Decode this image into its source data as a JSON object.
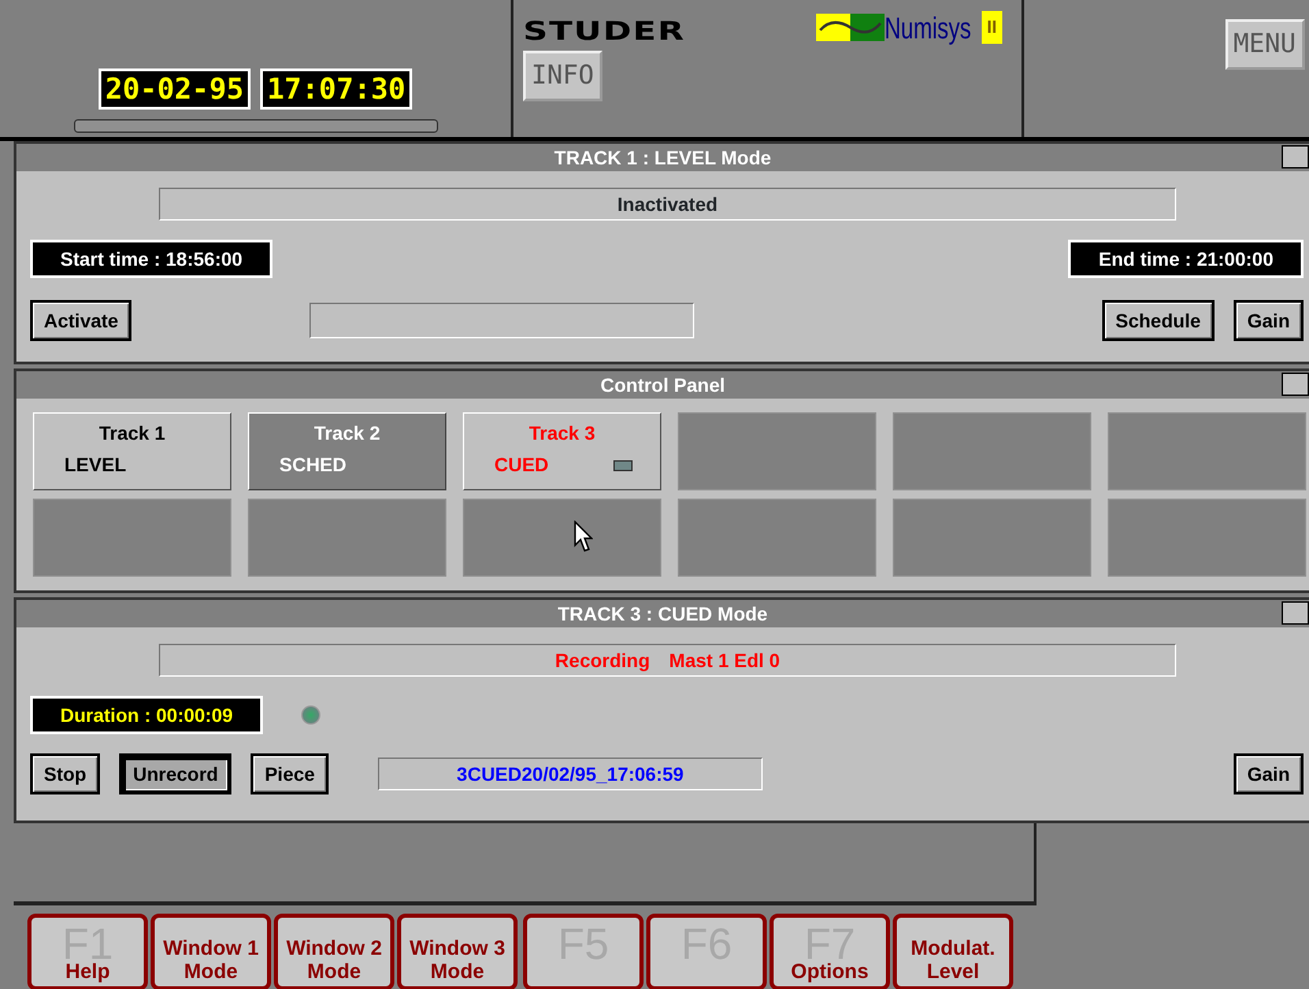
{
  "header": {
    "date": "20-02-95",
    "time": "17:07:30",
    "logo": "STUDER",
    "brand": "Numisys",
    "brand_suffix": "II",
    "info_button": "INFO",
    "menu_button": "MENU"
  },
  "track_window": {
    "title": "TRACK 1 : LEVEL Mode",
    "status": "Inactivated",
    "start_time": "Start time : 18:56:00",
    "end_time": "End time : 21:00:00",
    "left_buttons": [
      {
        "label": "Activate",
        "focused": false
      }
    ],
    "right_buttons": [
      {
        "label": "Schedule",
        "focused": false
      },
      {
        "label": "Gain",
        "focused": false
      }
    ]
  },
  "control_panel": {
    "title": "Control Panel",
    "slots": [
      {
        "kind": "idle",
        "name": "Track 1",
        "mode": "LEVEL"
      },
      {
        "kind": "scheduled",
        "name": "Track 2",
        "mode": "SCHED"
      },
      {
        "kind": "cued",
        "name": "Track 3",
        "mode": "CUED"
      },
      {
        "kind": "empty"
      },
      {
        "kind": "empty"
      },
      {
        "kind": "empty"
      },
      {
        "kind": "empty"
      },
      {
        "kind": "empty"
      },
      {
        "kind": "empty"
      },
      {
        "kind": "empty"
      },
      {
        "kind": "empty"
      },
      {
        "kind": "empty"
      }
    ]
  },
  "cued_window": {
    "title": "TRACK 3 : CUED Mode",
    "status": [
      "Recording",
      "Mast 1 Edl 0"
    ],
    "duration": "Duration : 00:00:09",
    "take_name": "3CUED20/02/95_17:06:59",
    "left_buttons": [
      {
        "label": "Stop",
        "focused": false
      },
      {
        "label": "Unrecord",
        "focused": true
      },
      {
        "label": "Piece",
        "focused": false
      }
    ],
    "right_buttons": [
      {
        "label": "Gain",
        "focused": false
      }
    ]
  },
  "function_keys": [
    {
      "key": "F1",
      "caption": [
        "Help"
      ]
    },
    {
      "caption": [
        "Window 1",
        "Mode"
      ]
    },
    {
      "caption": [
        "Window 2",
        "Mode"
      ]
    },
    {
      "caption": [
        "Window 3",
        "Mode"
      ]
    },
    {
      "key": "F5"
    },
    {
      "key": "F6"
    },
    {
      "key": "F7",
      "caption": [
        "Options"
      ]
    },
    {
      "caption": [
        "Modulat.",
        "Level"
      ]
    }
  ]
}
